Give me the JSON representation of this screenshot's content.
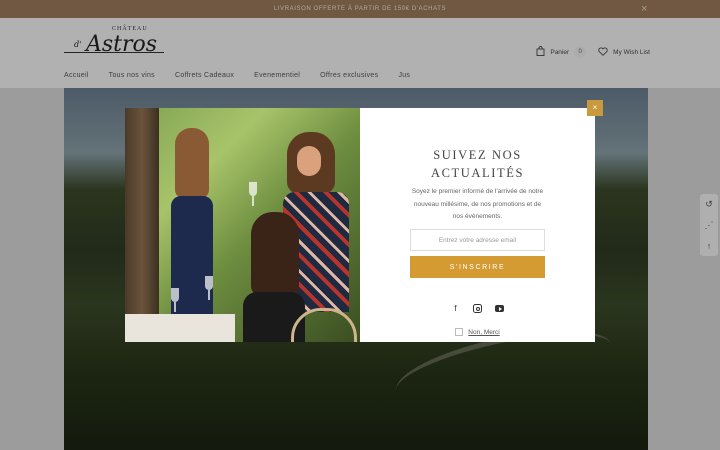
{
  "announcement": {
    "text": "LIVRAISON OFFERTE À PARTIR DE 150€ D'ACHATS",
    "close": "×"
  },
  "logo": {
    "small": "CHÂTEAU",
    "de": "d'",
    "main": "Astros"
  },
  "header": {
    "cart_label": "Panier",
    "cart_count": "0",
    "wishlist_label": "My Wish List"
  },
  "nav": [
    "Accueil",
    "Tous nos vins",
    "Coffrets Cadeaux",
    "Evenementiel",
    "Offres exclusives",
    "Jus"
  ],
  "side_tools": {
    "history": "↺",
    "share": "⋰",
    "top": "↑"
  },
  "modal": {
    "close": "×",
    "title_line1": "SUIVEZ NOS",
    "title_line2": "ACTUALITÉS",
    "description": "Soyez le premier informé de l'arrivée de notre nouveau millésime, de nos promotions et de nos évènements.",
    "email_placeholder": "Entrez votre adresse email",
    "subscribe_label": "S'INSCRIRE",
    "socials": {
      "facebook": "f"
    },
    "no_thanks": "Non, Merci"
  },
  "colors": {
    "accent": "#d49b32",
    "announcement_bg": "#9b7b5e",
    "close_bg": "#c89a3e"
  }
}
